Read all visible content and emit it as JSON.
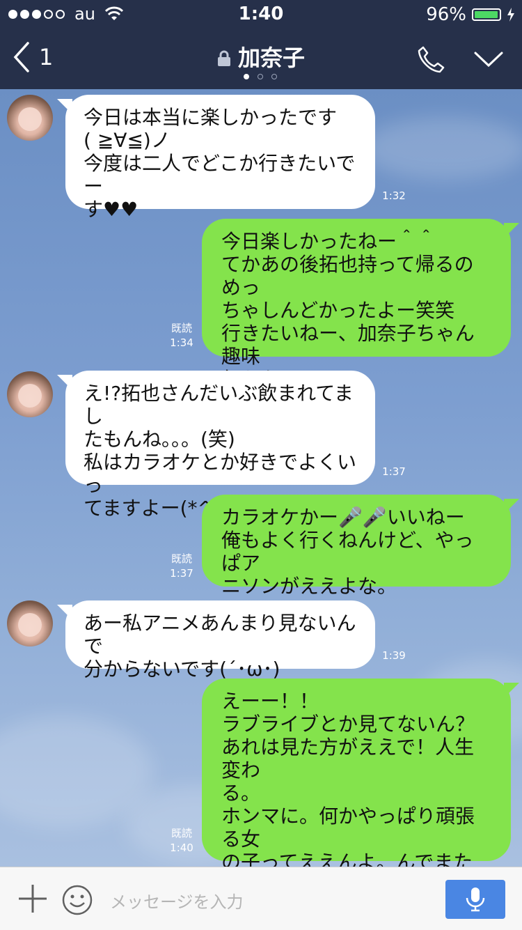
{
  "statusbar": {
    "carrier": "au",
    "time": "1:40",
    "battery": "96%",
    "battery_level": 0.96,
    "battery_color": "#4cd964"
  },
  "navbar": {
    "back_count": "1",
    "title": "加奈子",
    "pages": 3,
    "active_page": 1,
    "icons": [
      "chevron-left-icon",
      "lock-icon",
      "phone-icon",
      "chevron-down-icon"
    ]
  },
  "messages": [
    {
      "side": "in",
      "text": "今日は本当に楽しかったです\n( ≧∀≦)ノ\n今度は二人でどこか行きたいでー\nす♥♥",
      "time": "1:32"
    },
    {
      "side": "out",
      "text": "今日楽しかったねー＾＾\nてかあの後拓也持って帰るのめっ\nちゃしんどかったよー笑笑\n行きたいねー、加奈子ちゃん趣味\n何かな？",
      "read": "既読",
      "time": "1:34"
    },
    {
      "side": "in",
      "text": "え!?拓也さんだいぶ飲まれてまし\nたもんね。。。(笑)\n私はカラオケとか好きでよくいっ\nてますよー(*^。^*)",
      "time": "1:37"
    },
    {
      "side": "out",
      "text": "カラオケかー🎤🎤いいねー\n俺もよく行くねんけど、やっぱア\nニソンがええよな。",
      "read": "既読",
      "time": "1:37"
    },
    {
      "side": "in",
      "text": "あー私アニメあんまり見ないんで\n分からないです(´･ω･)",
      "time": "1:39"
    },
    {
      "side": "out",
      "text": "えーー！！\nラブライブとか見てないん？\nあれは見た方がええで！人生変わ\nる。\nホンマに。何かやっぱり頑張る女\nの子ってええんよ。んでまたキャ\nラが可愛い可愛い。",
      "read": "既読",
      "time": "1:40"
    }
  ],
  "input": {
    "placeholder": "メッセージを入力"
  },
  "colors": {
    "header": "#26304a",
    "bubble_out": "#84e34c",
    "bubble_in": "#ffffff",
    "mic_button": "#4a86e3"
  }
}
